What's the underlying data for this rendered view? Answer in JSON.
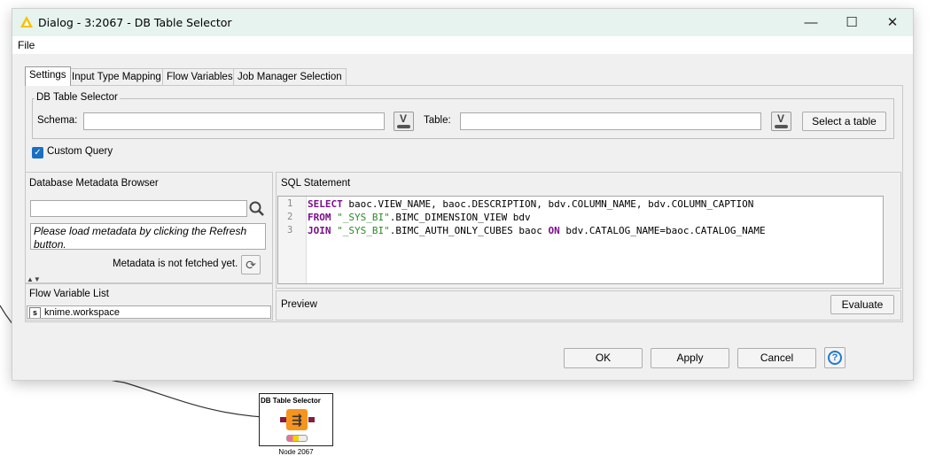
{
  "dialog": {
    "title": "Dialog - 3:2067 - DB Table Selector",
    "menu": {
      "file": "File"
    },
    "tabs": [
      "Settings",
      "Input Type Mapping",
      "Flow Variables",
      "Job Manager Selection"
    ],
    "db_table_selector": {
      "group_label": "DB Table Selector",
      "schema_label": "Schema:",
      "schema_value": "",
      "table_label": "Table:",
      "table_value": "",
      "select_table_button": "Select a table"
    },
    "custom_query": {
      "label": "Custom Query",
      "checked": true
    },
    "metadata_browser": {
      "title": "Database Metadata Browser",
      "search_value": "",
      "info_text": "Please load metadata by clicking the Refresh button.",
      "status": "Metadata is not fetched yet."
    },
    "flow_variable_list": {
      "title": "Flow Variable List",
      "items": [
        "knime.workspace"
      ]
    },
    "sql_statement": {
      "title": "SQL Statement",
      "line_numbers": [
        "1",
        "2",
        "3"
      ]
    },
    "preview": {
      "title": "Preview",
      "evaluate_button": "Evaluate"
    },
    "buttons": {
      "ok": "OK",
      "apply": "Apply",
      "cancel": "Cancel",
      "help": "?"
    }
  },
  "node": {
    "title": "DB Table Selector",
    "label": "Node 2067"
  },
  "colors": {
    "titlebar": "#e7f3ef",
    "checkbox": "#1a6fc0",
    "node_icon": "#f7941d",
    "sql_keyword": "#7a0f8c",
    "sql_string": "#2a8a2a"
  }
}
